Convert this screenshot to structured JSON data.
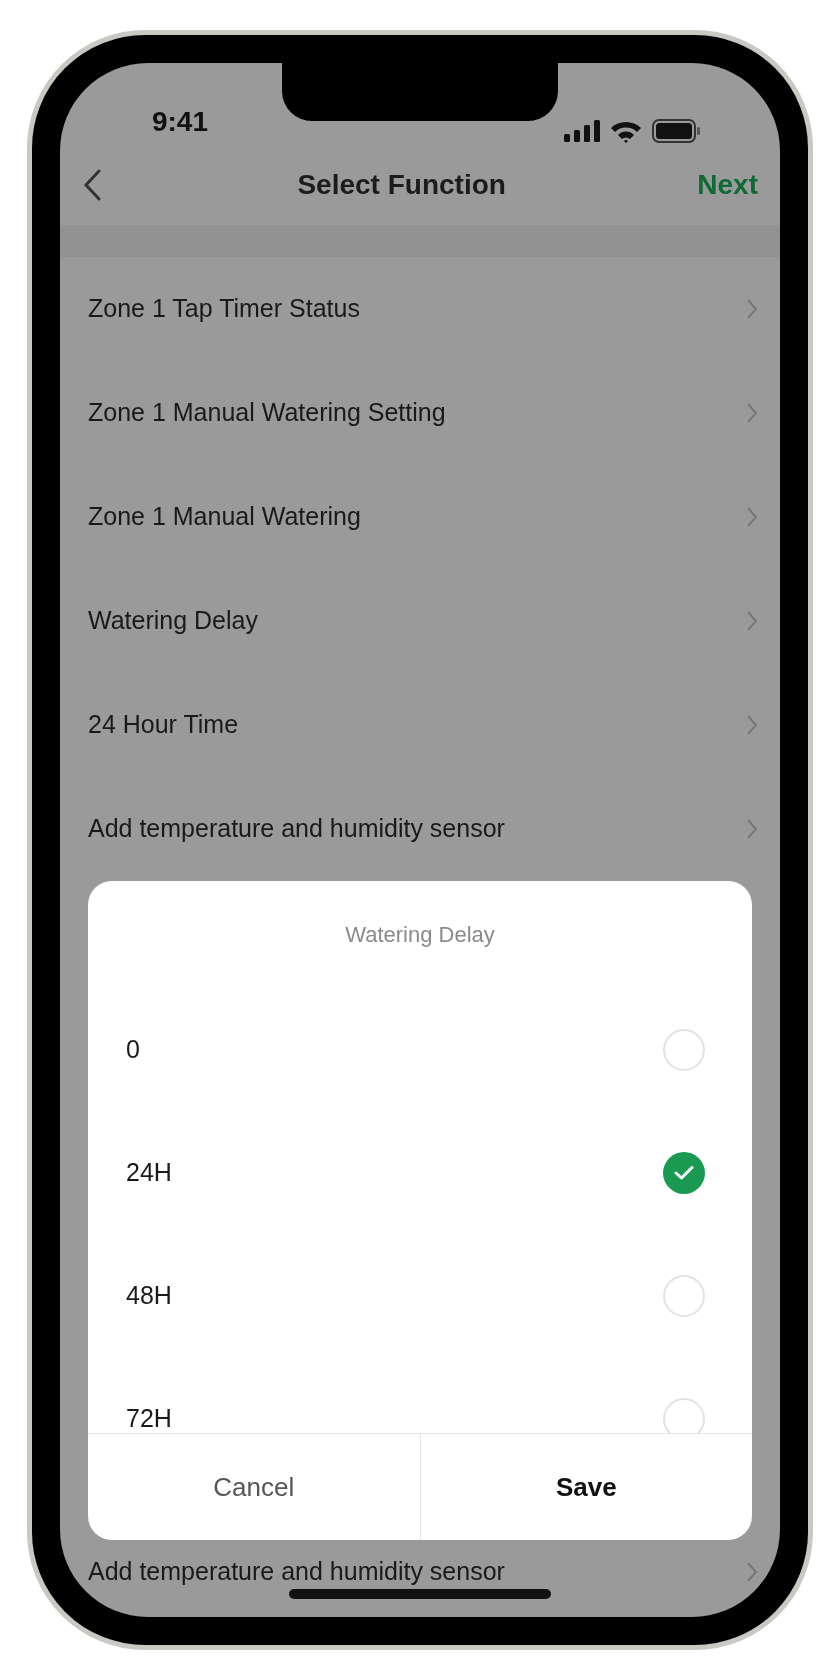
{
  "status_bar": {
    "time": "9:41"
  },
  "nav": {
    "title": "Select Function",
    "action": "Next"
  },
  "functions": [
    {
      "label": "Zone 1 Tap Timer Status"
    },
    {
      "label": "Zone 1 Manual Watering Setting"
    },
    {
      "label": "Zone 1 Manual Watering"
    },
    {
      "label": "Watering Delay"
    },
    {
      "label": "24 Hour Time"
    },
    {
      "label": "Add temperature and humidity sensor"
    },
    {
      "label": "Add temperature and humidity sensor"
    }
  ],
  "dialog": {
    "title": "Watering Delay",
    "options": [
      {
        "label": "0",
        "selected": false
      },
      {
        "label": "24H",
        "selected": true
      },
      {
        "label": "48H",
        "selected": false
      },
      {
        "label": "72H",
        "selected": false
      }
    ],
    "buttons": [
      {
        "label": "Cancel",
        "kind": "cancel"
      },
      {
        "label": "Save",
        "kind": "confirm"
      }
    ]
  }
}
